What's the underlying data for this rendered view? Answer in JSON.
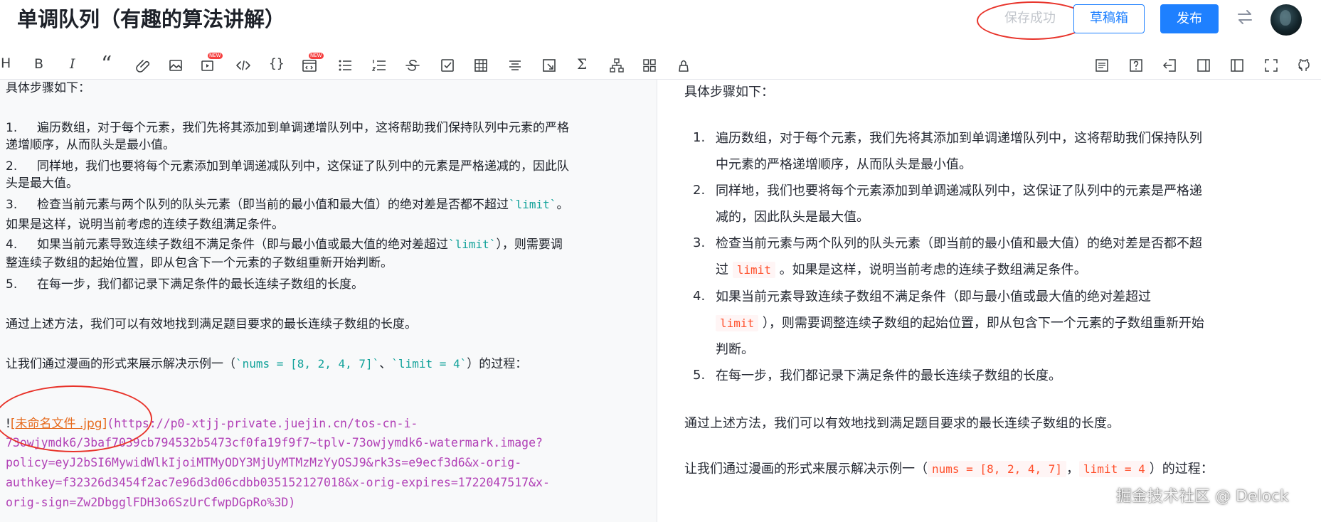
{
  "header": {
    "title": "单调队列（有趣的算法讲解）",
    "save_status": "保存成功",
    "drafts_label": "草稿箱",
    "publish_label": "发布",
    "switch_icon": "swap-arrows-icon",
    "avatar_icon": "user-avatar"
  },
  "toolbar": {
    "left_items": [
      {
        "name": "heading",
        "label": "H"
      },
      {
        "name": "bold",
        "label": "B"
      },
      {
        "name": "italic",
        "label": "I"
      },
      {
        "name": "quote",
        "label": "“"
      },
      {
        "name": "link"
      },
      {
        "name": "image"
      },
      {
        "name": "video",
        "badge": "NEW"
      },
      {
        "name": "code"
      },
      {
        "name": "code-block",
        "label": "{}"
      },
      {
        "name": "embed",
        "badge": "NEW"
      },
      {
        "name": "unordered-list"
      },
      {
        "name": "ordered-list"
      },
      {
        "name": "strikethrough"
      },
      {
        "name": "task-list"
      },
      {
        "name": "table"
      },
      {
        "name": "align-center"
      },
      {
        "name": "fullscreen-image"
      },
      {
        "name": "formula",
        "label": "Σ"
      },
      {
        "name": "diagram"
      },
      {
        "name": "grid"
      },
      {
        "name": "clear-format"
      }
    ],
    "right_items": [
      {
        "name": "catalog"
      },
      {
        "name": "help"
      },
      {
        "name": "exit"
      },
      {
        "name": "preview-right"
      },
      {
        "name": "preview-left"
      },
      {
        "name": "fullscreen"
      },
      {
        "name": "github"
      }
    ],
    "new_badge": "NEW",
    "accent": "#1e80ff"
  },
  "editor": {
    "intro": "具体步骤如下：",
    "steps": [
      {
        "num": "1.",
        "lines": [
          "遍历数组，对于每个元素，我们先将其添加到单调递增队列中，这将帮助我们保持队列中元素的严格",
          "递增顺序，从而队头是最小值。"
        ]
      },
      {
        "num": "2.",
        "lines": [
          "同样地，我们也要将每个元素添加到单调递减队列中，这保证了队列中的元素是严格递减的，因此队",
          "头是最大值。"
        ]
      },
      {
        "num": "3.",
        "line1_before": "检查当前元素与两个队列的队头元素（即当前的最小值和最大值）的绝对差是否都不超过",
        "line1_code": "`limit`",
        "line1_after": "。",
        "line2": "如果是这样，说明当前考虑的连续子数组满足条件。"
      },
      {
        "num": "4.",
        "line1_before": "如果当前元素导致连续子数组不满足条件（即与最小值或最大值的绝对差超过",
        "line1_code": "`limit`",
        "line1_after": "），则需要调",
        "line2": "整连续子数组的起始位置，即从包含下一个元素的子数组重新开始判断。"
      },
      {
        "num": "5.",
        "lines": [
          "在每一步，我们都记录下满足条件的最长连续子数组的长度。"
        ]
      }
    ],
    "summary": "通过上述方法，我们可以有效地找到满足题目要求的最长连续子数组的长度。",
    "example_before": "让我们通过漫画的形式来展示解决示例一（",
    "example_code1": "`nums = [8, 2, 4, 7]`",
    "example_sep": "、",
    "example_code2": "`limit = 4`",
    "example_after": "）的过程：",
    "image_bang": "!",
    "image_alt": "[未命名文件 .jpg]",
    "image_url_lines": [
      "(https://p0-xtjj-private.juejin.cn/tos-cn-i-",
      "73owjymdk6/3baf7039cb794532b5473cf0fa19f9f7~tplv-73owjymdk6-watermark.image?",
      "policy=eyJ2bSI6MywidWlkIjoiMTMyODY3MjUyMTMzMzYyOSJ9&rk3s=e9ecf3d6&x-orig-",
      "authkey=f32326d3454f2ac7e96d3d06cdbb035152127018&x-orig-expires=1722047517&x-",
      "orig-sign=Zw2DbgglFDH3o6SzUrCfwpDGpRo%3D)"
    ]
  },
  "preview": {
    "intro": "具体步骤如下：",
    "items": [
      {
        "num": "1.",
        "lines": [
          "遍历数组，对于每个元素，我们先将其添加到单调递增队列中，这将帮助我们保持队列",
          "中元素的严格递增顺序，从而队头是最小值。"
        ]
      },
      {
        "num": "2.",
        "lines": [
          "同样地，我们也要将每个元素添加到单调递减队列中，这保证了队列中的元素是严格递",
          "减的，因此队头是最大值。"
        ]
      },
      {
        "num": "3.",
        "line1": "检查当前元素与两个队列的队头元素（即当前的最小值和最大值）的绝对差是否都不超",
        "line2_before": "过",
        "line2_code": "limit",
        "line2_after": "。如果是这样，说明当前考虑的连续子数组满足条件。"
      },
      {
        "num": "4.",
        "line1": "如果当前元素导致连续子数组不满足条件（即与最小值或最大值的绝对差超过",
        "line2_code": "limit",
        "line2_after": "），则需要调整连续子数组的起始位置，即从包含下一个元素的子数组重新开始",
        "line3": "判断。"
      },
      {
        "num": "5.",
        "lines": [
          "在每一步，我们都记录下满足条件的最长连续子数组的长度。"
        ]
      }
    ],
    "summary": "通过上述方法，我们可以有效地找到满足题目要求的最长连续子数组的长度。",
    "example_before": "让我们通过漫画的形式来展示解决示例一（",
    "example_code1": "nums = [8, 2, 4, 7]",
    "example_sep": "，",
    "example_code2": "limit = 4",
    "example_after": "）的过程：",
    "watermark": "掘金技术社区 @ Delock"
  },
  "colors": {
    "publish_bg": "#1e80ff",
    "annotation_circle": "#e8332a",
    "inline_code_preview": "#ff502c",
    "inline_code_editor": "#12a29a",
    "url_color": "#b140b6",
    "link_text_color": "#e66b1e"
  }
}
